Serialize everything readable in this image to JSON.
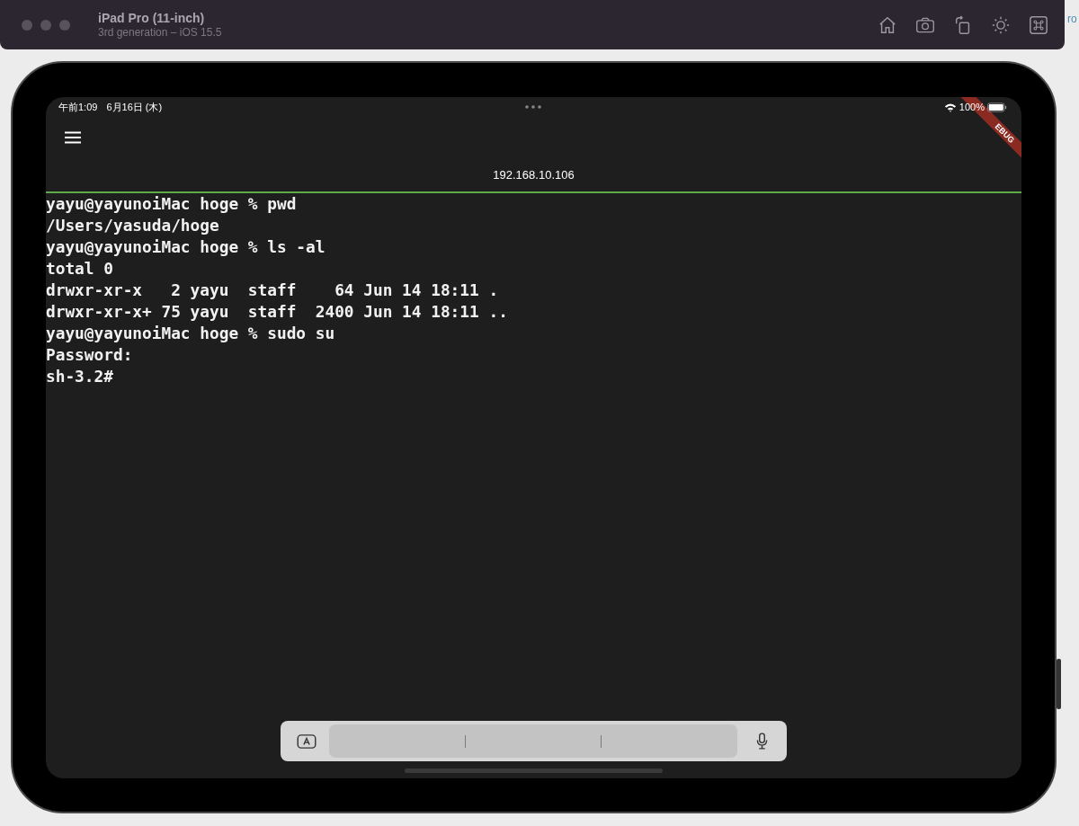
{
  "simulator": {
    "device_name": "iPad Pro (11-inch)",
    "device_detail": "3rd generation – iOS 15.5"
  },
  "background_window_text": "ro",
  "status_bar": {
    "time": "午前1:09",
    "date": "6月16日 (木)",
    "battery": "100%"
  },
  "debug_banner": "EBUG",
  "app_bar": {
    "title": "192.168.10.106"
  },
  "terminal": {
    "lines": [
      "yayu@yayunoiMac hoge % pwd",
      "/Users/yasuda/hoge",
      "yayu@yayunoiMac hoge % ls -al",
      "total 0",
      "drwxr-xr-x   2 yayu  staff    64 Jun 14 18:11 .",
      "drwxr-xr-x+ 75 yayu  staff  2400 Jun 14 18:11 ..",
      "yayu@yayunoiMac hoge % sudo su",
      "Password:",
      "sh-3.2#"
    ]
  }
}
